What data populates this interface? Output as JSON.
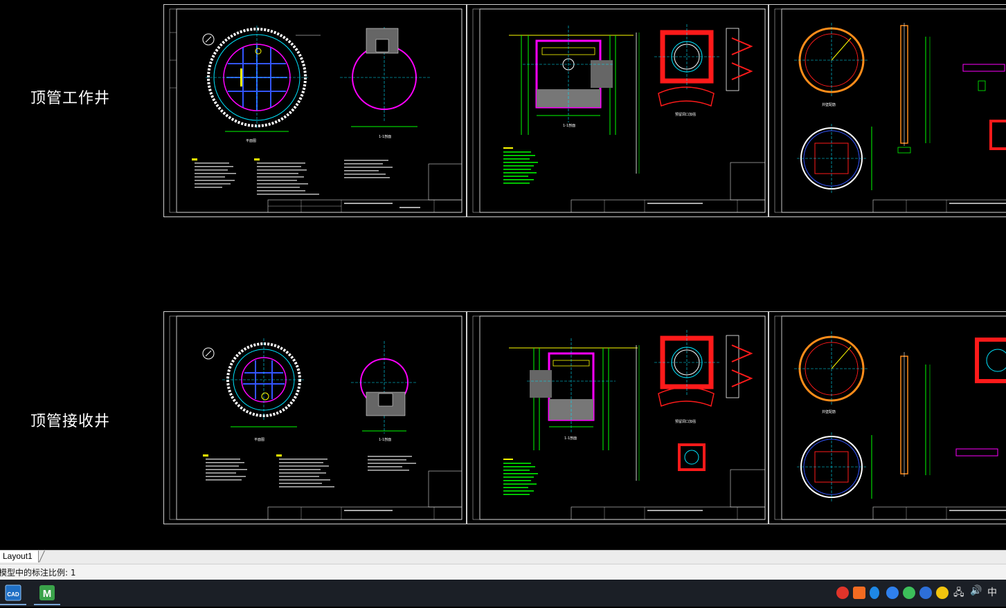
{
  "canvas": {
    "row_labels": [
      "顶管工作井",
      "顶管接收井"
    ]
  },
  "tabs": {
    "layout1_label": "Layout1"
  },
  "status": {
    "text": "模型中的标注比例: 1"
  },
  "taskbar": {
    "apps": [
      {
        "name": "cad-app",
        "label": "CAD"
      },
      {
        "name": "maxthon-app",
        "label": "M"
      }
    ],
    "tray": [
      {
        "name": "red-app-icon",
        "color": "#e0342a"
      },
      {
        "name": "orange-app-icon",
        "color": "#f36b21"
      },
      {
        "name": "bluetooth-icon",
        "color": "#1e88e5"
      },
      {
        "name": "g-app-icon",
        "color": "#2f80ed"
      },
      {
        "name": "wechat-icon",
        "color": "#3cbf5a"
      },
      {
        "name": "s-app-icon",
        "color": "#2d6fd8"
      },
      {
        "name": "plus-app-icon",
        "color": "#f1c40f"
      }
    ],
    "ime_label": "中"
  },
  "colors": {
    "cad_bg": "#000000",
    "sheet_border": "#cfcfcf",
    "magenta": "#ff00ff",
    "cyan": "#00e5ff",
    "red": "#ff1a1a",
    "green": "#00ff00",
    "yellow": "#ffff00",
    "white": "#ffffff"
  }
}
